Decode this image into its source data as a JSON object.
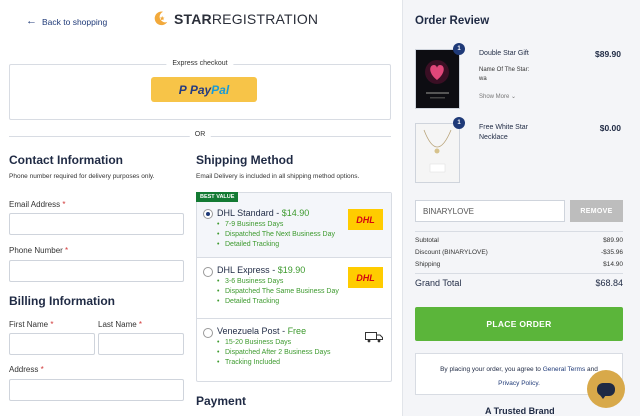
{
  "header": {
    "back_label": "Back to shopping",
    "logo_bold": "STAR",
    "logo_rest": "REGISTRATION"
  },
  "express": {
    "label": "Express checkout",
    "paypal_1": "Pay",
    "paypal_2": "Pal",
    "or_label": "OR"
  },
  "contact": {
    "title": "Contact Information",
    "subtitle": "Phone number required for delivery purposes only.",
    "email_label": "Email Address",
    "phone_label": "Phone Number",
    "required_mark": "*"
  },
  "billing": {
    "title": "Billing Information",
    "first_name_label": "First Name",
    "last_name_label": "Last Name",
    "address_label": "Address"
  },
  "shipping": {
    "title": "Shipping Method",
    "subtitle": "Email Delivery is included in all shipping method options.",
    "badge": "BEST VALUE",
    "options": [
      {
        "name": "DHL Standard",
        "price": "$14.90",
        "features": [
          "7-9 Business Days",
          "Dispatched The Next Business Day",
          "Detailed Tracking"
        ],
        "logo": "DHL",
        "selected": true
      },
      {
        "name": "DHL Express",
        "price": "$19.90",
        "features": [
          "3-6 Business Days",
          "Dispatched The Same Business Day",
          "Detailed Tracking"
        ],
        "logo": "DHL",
        "selected": false
      },
      {
        "name": "Venezuela Post",
        "price": "Free",
        "features": [
          "15-20 Business Days",
          "Dispatched After 2 Business Days",
          "Tracking Included"
        ],
        "logo": "truck-icon",
        "selected": false
      }
    ]
  },
  "payment": {
    "title": "Payment"
  },
  "order": {
    "title": "Order Review",
    "items": [
      {
        "qty": "1",
        "name": "Double Star Gift",
        "price": "$89.90",
        "meta_label": "Name Of The Star:",
        "meta_value": "wa",
        "show_more": "Show More"
      },
      {
        "qty": "1",
        "name": "Free White Star Necklace",
        "price": "$0.00"
      }
    ],
    "promo_value": "BINARYLOVE",
    "remove_label": "REMOVE",
    "totals": {
      "subtotal_label": "Subtotal",
      "subtotal": "$89.90",
      "discount_label": "Discount (BINARYLOVE)",
      "discount": "-$35.96",
      "shipping_label": "Shipping",
      "shipping": "$14.90",
      "grand_label": "Grand Total",
      "grand": "$68.84"
    },
    "place_order": "PLACE ORDER",
    "terms_1": "By placing your order, you agree to",
    "terms_link_1": "General Terms",
    "terms_and": "and",
    "terms_link_2": "Privacy Policy.",
    "trusted": "A Trusted Brand"
  },
  "colors": {
    "accent_green": "#5bb53a",
    "navy": "#1f3a78",
    "dhl_yellow": "#ffcc00",
    "paypal_yellow": "#f7c448"
  }
}
